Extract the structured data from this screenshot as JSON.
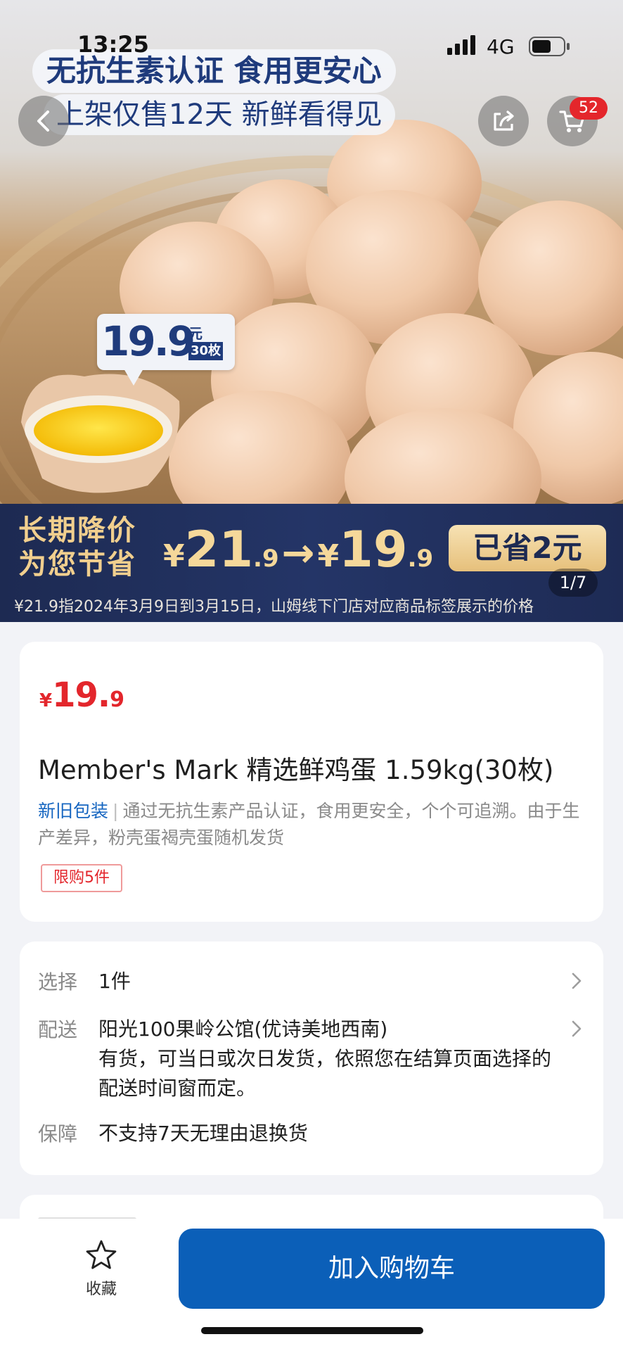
{
  "status_bar": {
    "time": "13:25",
    "network": "4G",
    "icons": [
      "signal-icon",
      "battery-icon"
    ]
  },
  "hero": {
    "headline": "无抗生素认证 食用更安心",
    "subline": "上架仅售12天 新鲜看得见",
    "price_tag": {
      "price": "19.9",
      "unit": "元",
      "count": "30枚"
    },
    "promo": {
      "left_line1": "长期降价",
      "left_line2": "为您节省",
      "yen_symbol": "¥",
      "old_int": "21",
      "old_dec": ".9",
      "arrow": "→",
      "new_int": "19",
      "new_dec": ".9",
      "saved": "已省2元",
      "note": "¥21.9指2024年3月9日到3月15日，山姆线下门店对应商品标签展示的价格"
    },
    "pager": "1/7"
  },
  "nav": {
    "cart_count": "52",
    "icons": [
      "back-arrow-icon",
      "share-icon",
      "cart-icon"
    ]
  },
  "product": {
    "price": {
      "yen": "¥",
      "int": "19.",
      "dec": "9"
    },
    "title": "Member's Mark 精选鲜鸡蛋 1.59kg(30枚)",
    "package_link": "新旧包装",
    "separator": "|",
    "description": "通过无抗生素产品认证，食用更安全，个个可追溯。由于生产差异，粉壳蛋褐壳蛋随机发货",
    "limit_tag": "限购5件"
  },
  "details": {
    "select_label": "选择",
    "select_value": "1件",
    "ship_label": "配送",
    "ship_address": "阳光100果岭公馆(优诗美地西南)",
    "ship_note": "有货，可当日或次日发货，依照您在结算页面选择的配送时间窗而定。",
    "guarantee_label": "保障",
    "guarantee_value": "不支持7天无理由退换货"
  },
  "bottom_bar": {
    "favorite_label": "收藏",
    "add_to_cart": "加入购物车"
  },
  "colors": {
    "accent": "#0b5fb8",
    "price_red": "#e3262c",
    "promo_navy": "#1d2a52",
    "promo_gold": "#f5d89a",
    "link_blue": "#1565c0"
  }
}
